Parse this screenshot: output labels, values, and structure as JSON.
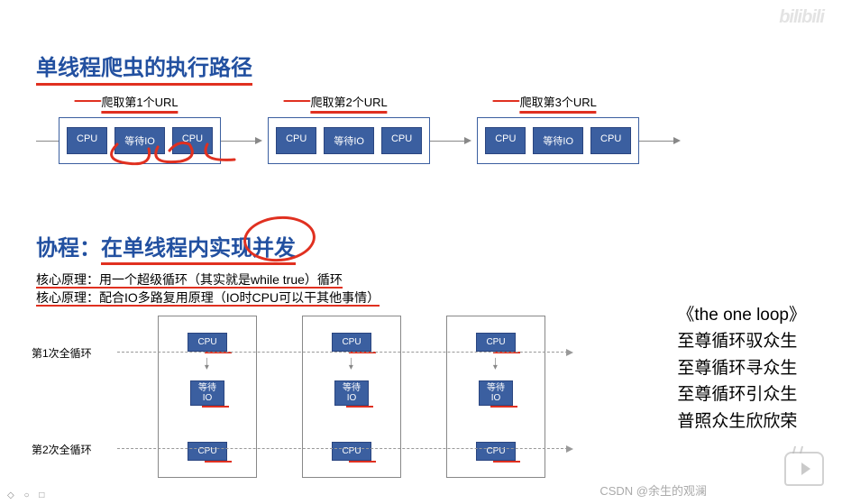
{
  "title1": "单线程爬虫的执行路径",
  "row1": {
    "blocks": [
      {
        "label": "爬取第1个URL",
        "cells": [
          "CPU",
          "等待IO",
          "CPU"
        ]
      },
      {
        "label": "爬取第2个URL",
        "cells": [
          "CPU",
          "等待IO",
          "CPU"
        ]
      },
      {
        "label": "爬取第3个URL",
        "cells": [
          "CPU",
          "等待IO",
          "CPU"
        ]
      }
    ]
  },
  "title2": {
    "prefix": "协程：",
    "underlined": "在单线程内实现并发"
  },
  "principles": {
    "label": "核心原理：",
    "p1": "用一个超级循环（其实就是while true）循环",
    "p2": "配合IO多路复用原理（IO时CPU可以干其他事情）"
  },
  "diagram2": {
    "loop1_label": "第1次全循环",
    "loop2_label": "第2次全循环",
    "col": {
      "cpu": "CPU",
      "io_l1": "等待",
      "io_l2": "IO"
    }
  },
  "poem": {
    "title": "《the one loop》",
    "lines": [
      "至尊循环驭众生",
      "至尊循环寻众生",
      "至尊循环引众生",
      "普照众生欣欣荣"
    ]
  },
  "watermark": "CSDN @余生的观澜",
  "bilibili": "bilibili",
  "toolbar": "◇ ○ □"
}
